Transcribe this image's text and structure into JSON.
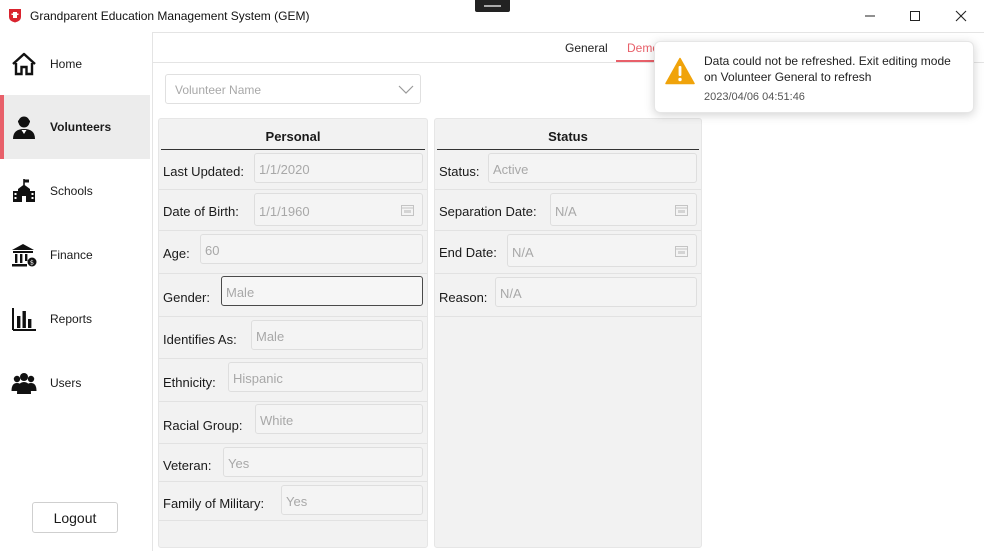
{
  "app": {
    "title": "Grandparent Education Management System (GEM)"
  },
  "nav": {
    "items": [
      {
        "label": "Home",
        "icon": "home-icon"
      },
      {
        "label": "Volunteers",
        "icon": "volunteer-icon",
        "active": true
      },
      {
        "label": "Schools",
        "icon": "school-icon"
      },
      {
        "label": "Finance",
        "icon": "bank-icon"
      },
      {
        "label": "Reports",
        "icon": "bar-chart-icon"
      },
      {
        "label": "Users",
        "icon": "users-icon"
      }
    ],
    "logout_label": "Logout"
  },
  "tabs": {
    "general": "General",
    "demographics": "Demo"
  },
  "volunteer_select": {
    "placeholder": "Volunteer Name"
  },
  "personal": {
    "title": "Personal",
    "last_updated": {
      "label": "Last Updated:",
      "value": "1/1/2020"
    },
    "dob": {
      "label": "Date of Birth:",
      "value": "1/1/1960"
    },
    "age": {
      "label": "Age:",
      "value": "60"
    },
    "gender": {
      "label": "Gender:",
      "value": "Male"
    },
    "identifies_as": {
      "label": "Identifies As:",
      "value": "Male"
    },
    "ethnicity": {
      "label": "Ethnicity:",
      "value": "Hispanic"
    },
    "racial_group": {
      "label": "Racial Group:",
      "value": "White"
    },
    "veteran": {
      "label": "Veteran:",
      "value": "Yes"
    },
    "family_military": {
      "label": "Family of Military:",
      "value": "Yes"
    }
  },
  "status": {
    "title": "Status",
    "status": {
      "label": "Status:",
      "value": "Active"
    },
    "separation_date": {
      "label": "Separation Date:",
      "value": "N/A"
    },
    "end_date": {
      "label": "End Date:",
      "value": "N/A"
    },
    "reason": {
      "label": "Reason:",
      "value": "N/A"
    }
  },
  "toast": {
    "message": "Data could not be refreshed. Exit editing mode on Volunteer General to refresh",
    "timestamp": "2023/04/06 04:51:46"
  },
  "colors": {
    "accent": "#e8606a",
    "warning": "#f0a30a"
  }
}
